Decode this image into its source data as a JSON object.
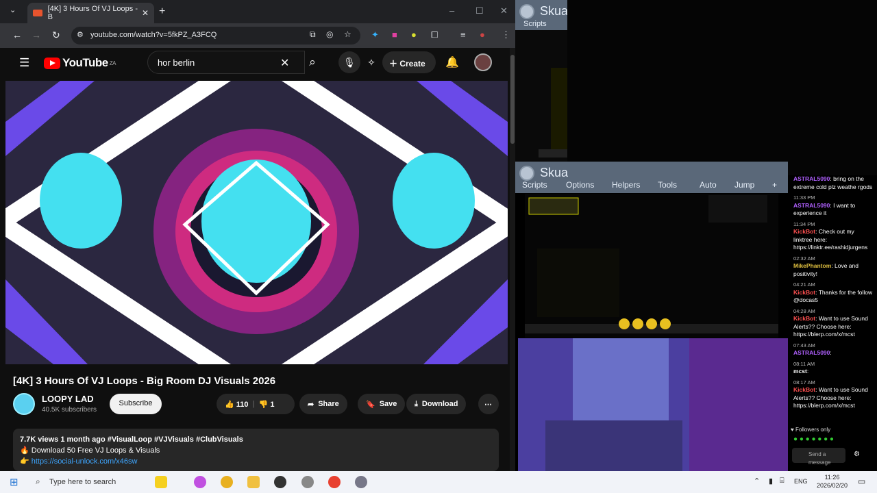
{
  "browser": {
    "tab_title": "[4K] 3 Hours Of VJ Loops - B",
    "url": "youtube.com/watch?v=5fkPZ_A3FCQ",
    "window_buttons": [
      "–",
      "☐",
      "✕"
    ]
  },
  "youtube": {
    "logo": "YouTube",
    "region": "ZA",
    "search_value": "hor berlin",
    "create_label": "Create",
    "video_title": "[4K] 3 Hours Of VJ Loops - Big Room DJ Visuals 2026",
    "channel_name": "LOOPY LAD",
    "subscribers": "40.5K subscribers",
    "subscribe_label": "Subscribe",
    "likes": "110",
    "dislikes": "1",
    "share_label": "Share",
    "save_label": "Save",
    "download_label": "Download",
    "description": {
      "meta": "7.7K views  1 month ago  #VisualLoop #VJVisuals #ClubVisuals",
      "line1": "🔥 Download 50 Free VJ Loops & Visuals",
      "line2": "👉 https://social-unlock.com/x46sw"
    }
  },
  "skua1": {
    "title": "Skua",
    "tab": "Scripts"
  },
  "skua2": {
    "title": "Skua",
    "tabs": [
      "Scripts",
      "Options",
      "Helpers",
      "Tools",
      "Auto",
      "Jump",
      "+"
    ]
  },
  "chat": {
    "messages": [
      {
        "time": "",
        "user": "ASTRAL5090",
        "text": ": bring on the extreme cold plz weathe rgods",
        "color": "#b060ff"
      },
      {
        "time": "11:33 PM",
        "user": "ASTRAL5090",
        "text": ": I want to experience it",
        "color": "#b060ff"
      },
      {
        "time": "11:34 PM",
        "user": "KickBot",
        "text": ": Check out my linktree here: https://linktr.ee/rashidjurgens",
        "color": "#ff5050"
      },
      {
        "time": "02:32 AM",
        "user": "MikePhantom",
        "text": ": Love and positivity!",
        "color": "#e0c040"
      },
      {
        "time": "04:21 AM",
        "user": "KickBot",
        "text": ": Thanks for the follow @docas5",
        "color": "#ff5050"
      },
      {
        "time": "04:28 AM",
        "user": "KickBot",
        "text": ": Want to use Sound Alerts?? Choose here: https://blerp.com/x/mcst",
        "color": "#ff5050"
      },
      {
        "time": "07:43 AM",
        "user": "ASTRAL5090",
        "text": ":",
        "color": "#b060ff"
      },
      {
        "time": "08:11 AM",
        "user": "mcst",
        "text": ":",
        "color": "#ffffff"
      },
      {
        "time": "08:17 AM",
        "user": "KickBot",
        "text": ": Want to use Sound Alerts?? Choose here: https://blerp.com/x/mcst",
        "color": "#ff5050"
      }
    ],
    "followers_only": "Followers only",
    "send_placeholder": "Send a message"
  },
  "taskbar": {
    "search_placeholder": "Type here to search",
    "lang": "ENG",
    "time": "11:26",
    "date": "2026/02/20"
  }
}
